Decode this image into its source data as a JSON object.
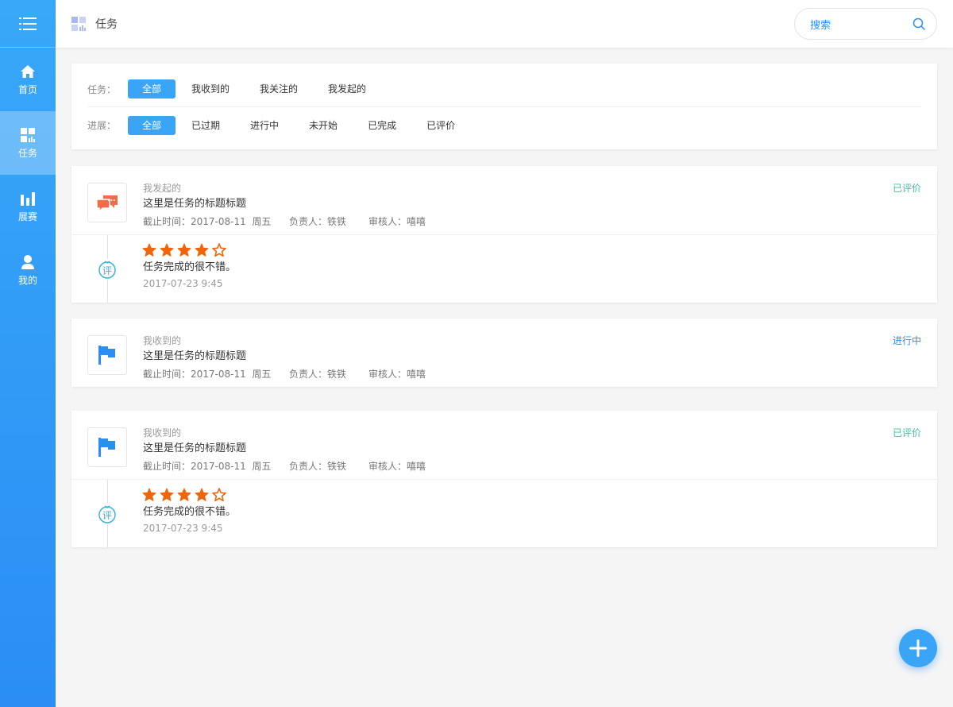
{
  "sidebar": {
    "menu_icon": "menu-icon",
    "items": [
      {
        "label": "首页",
        "icon": "home-icon"
      },
      {
        "label": "任务",
        "icon": "dashboard-icon",
        "active": true
      },
      {
        "label": "展赛",
        "icon": "bar-chart-icon"
      },
      {
        "label": "我的",
        "icon": "user-icon"
      }
    ]
  },
  "header": {
    "title": "任务",
    "search_placeholder": "搜索"
  },
  "filters": {
    "task_label": "任务：",
    "task_options": [
      "全部",
      "我收到的",
      "我关注的",
      "我发起的"
    ],
    "task_selected": "全部",
    "progress_label": "进展：",
    "progress_options": [
      "全部",
      "已过期",
      "进行中",
      "未开始",
      "已完成",
      "已评价"
    ],
    "progress_selected": "全部"
  },
  "tasks": [
    {
      "category": "我发起的",
      "title": "这里是任务的标题标题",
      "deadline": "截止时间：2017-08-11  周五",
      "owner": "负责人：铁铁",
      "reviewer": "审核人：嘻嘻",
      "status": "已评价",
      "icon": "chat-bubbles-icon",
      "review": {
        "rating": 4,
        "max": 5,
        "text": "任务完成的很不错。",
        "date": "2017-07-23 9:45",
        "icon": "review-badge-icon"
      }
    },
    {
      "category": "我收到的",
      "title": "这里是任务的标题标题",
      "deadline": "截止时间：2017-08-11  周五",
      "owner": "负责人：铁铁",
      "reviewer": "审核人：嘻嘻",
      "status": "进行中",
      "icon": "flag-icon"
    },
    {
      "category": "我收到的",
      "title": "这里是任务的标题标题",
      "deadline": "截止时间：2017-08-11  周五",
      "owner": "负责人：铁铁",
      "reviewer": "审核人：嘻嘻",
      "status": "已评价",
      "icon": "flag-icon",
      "review": {
        "rating": 4,
        "max": 5,
        "text": "任务完成的很不错。",
        "date": "2017-07-23 9:45",
        "icon": "review-badge-icon"
      }
    }
  ],
  "fab": {
    "icon": "plus-icon"
  },
  "colors": {
    "primary": "#2a8ef5",
    "accent_chip": "#3aa5f6",
    "status_done": "#3fc4a0",
    "star": "#f0640a",
    "chat_icon": "#f46b45"
  }
}
